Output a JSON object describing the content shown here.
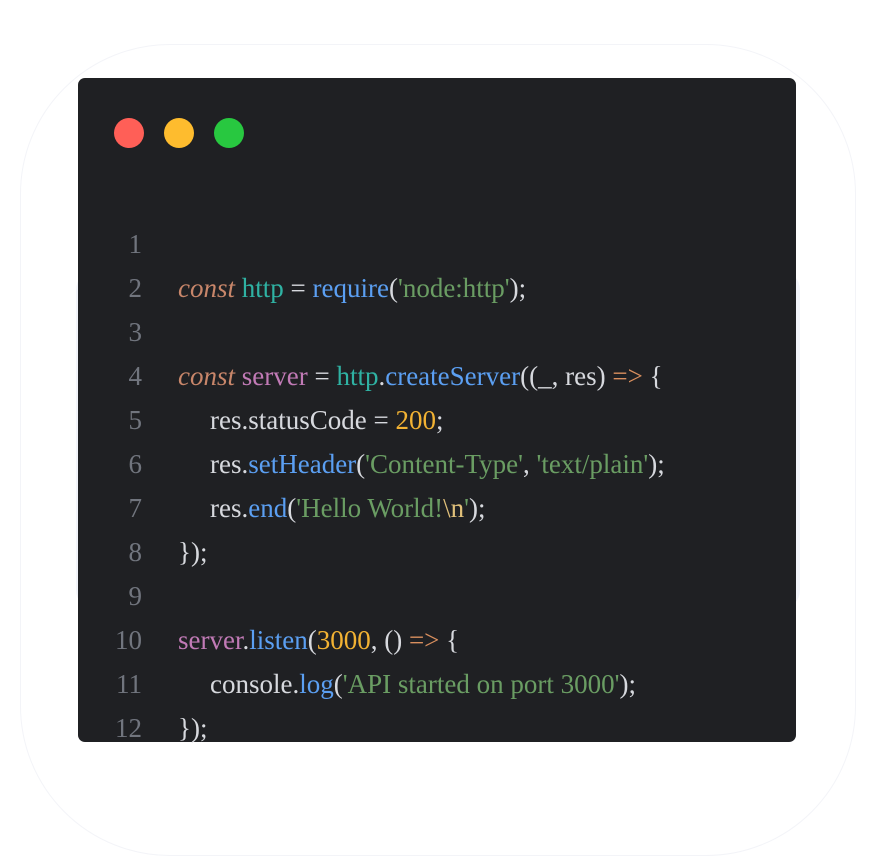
{
  "colors": {
    "window_bg": "#1f2023",
    "line_number": "#71757e",
    "plain": "#d7d9de",
    "keyword": "#c8866a",
    "module": "#2fb2a3",
    "function": "#5b9ff2",
    "string": "#6a9d63",
    "number": "#f2b233",
    "variable": "#c17ab6",
    "arrow": "#d98f5e",
    "dot_red": "#ff5f57",
    "dot_yellow": "#febc2e",
    "dot_green": "#28c840"
  },
  "code": {
    "line_numbers": [
      "1",
      "2",
      "3",
      "4",
      "5",
      "6",
      "7",
      "8",
      "9",
      "10",
      "11",
      "12"
    ],
    "l1": [
      "const",
      " ",
      "http",
      " = ",
      "require",
      "(",
      "'node:http'",
      ");"
    ],
    "l3": [
      "const",
      " ",
      "server",
      " = ",
      "http",
      ".",
      "createServer",
      "((_, res) ",
      "=>",
      " {"
    ],
    "l4": [
      "res.statusCode = ",
      "200",
      ";"
    ],
    "l5": [
      "res.",
      "setHeader",
      "(",
      "'Content-Type'",
      ", ",
      "'text/plain'",
      ");"
    ],
    "l6": [
      "res.",
      "end",
      "(",
      "'Hello World!",
      "\\n",
      "'",
      ");"
    ],
    "l7": [
      "});"
    ],
    "l9": [
      "server",
      ".",
      "listen",
      "(",
      "3000",
      ", () ",
      "=>",
      " {"
    ],
    "l10": [
      "console.",
      "log",
      "(",
      "'API started on port 3000'",
      ");"
    ],
    "l11": [
      "});"
    ]
  }
}
